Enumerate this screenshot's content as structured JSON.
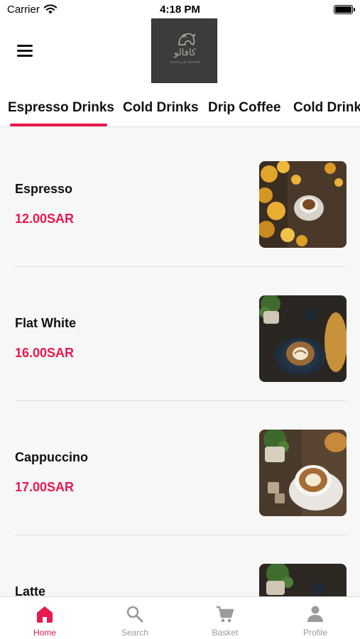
{
  "status_bar": {
    "carrier": "Carrier",
    "time": "4:18 PM"
  },
  "header": {
    "logo": {
      "arabic_text": "كافالو",
      "english_text": "CAVALLO CAFFE"
    }
  },
  "categories": {
    "selected": "Espresso Drinks",
    "items": [
      {
        "label": "Espresso Drinks"
      },
      {
        "label": "Cold Drinks"
      },
      {
        "label": "Drip Coffee"
      },
      {
        "label": "Cold Drinks"
      }
    ]
  },
  "products": [
    {
      "name": "Espresso",
      "price": "12.00SAR"
    },
    {
      "name": "Flat White",
      "price": "16.00SAR"
    },
    {
      "name": "Cappuccino",
      "price": "17.00SAR"
    },
    {
      "name": "Latte",
      "price": ""
    }
  ],
  "bottom_nav": {
    "active": "Home",
    "items": [
      {
        "label": "Home",
        "icon": "home-icon"
      },
      {
        "label": "Search",
        "icon": "search-icon"
      },
      {
        "label": "Basket",
        "icon": "cart-icon"
      },
      {
        "label": "Profile",
        "icon": "person-icon"
      }
    ]
  },
  "colors": {
    "accent": "#e8194d",
    "inactive": "#9b9b9b",
    "background": "#f7f7f7"
  }
}
